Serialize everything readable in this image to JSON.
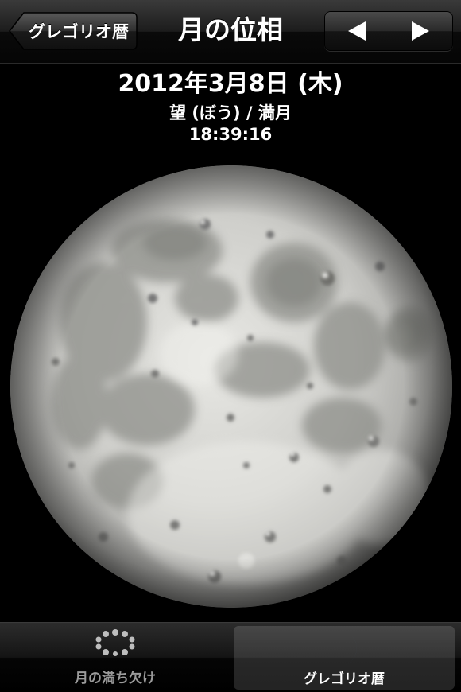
{
  "nav": {
    "back_label": "グレゴリオ暦",
    "title": "月の位相",
    "prev_arrow": "◀",
    "next_arrow": "▶"
  },
  "info": {
    "date": "2012年3月8日 (木)",
    "phase": "望 (ぼう) / 満月",
    "time": "18:39:16"
  },
  "tabs": [
    {
      "label": "月の満ち欠け",
      "icon": "moon-phases-icon",
      "selected": false
    },
    {
      "label": "グレゴリオ暦",
      "icon": "crescent-moon-icon",
      "selected": true
    }
  ],
  "colors": {
    "background": "#000000",
    "moon_highlight": "#e6e6e2",
    "moon_shadow": "#5a5a58",
    "crescent_blue": "#3aa0ff"
  }
}
